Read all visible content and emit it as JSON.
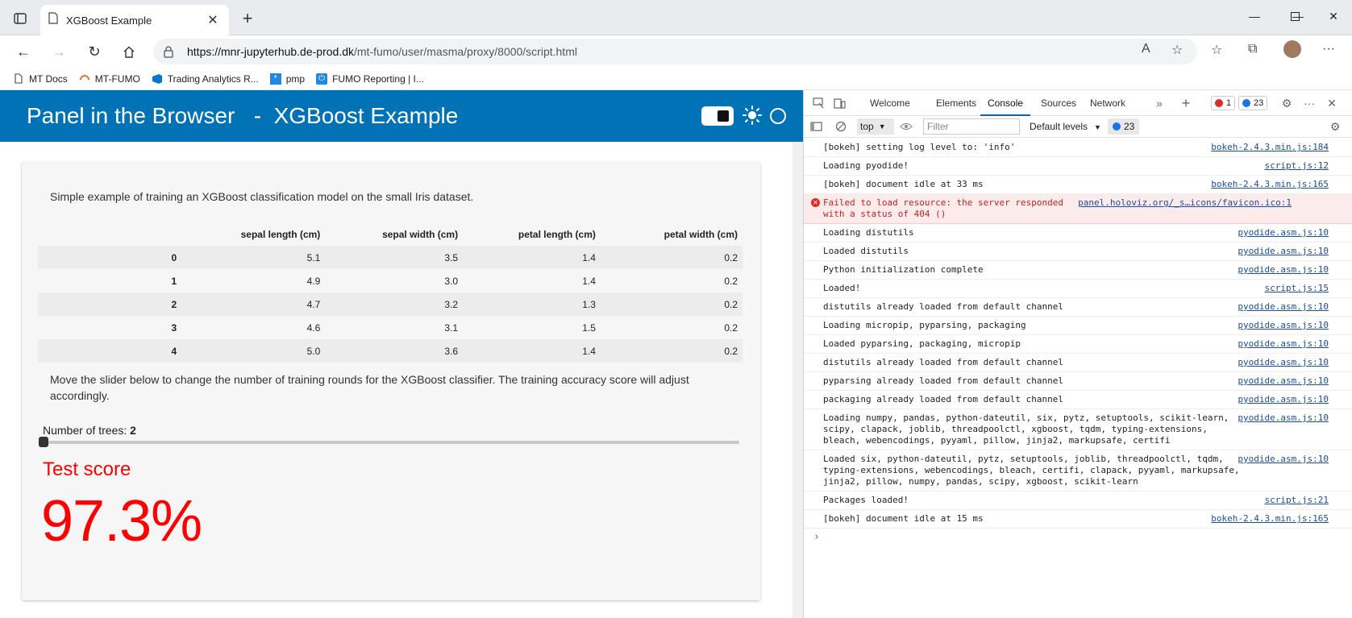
{
  "browser": {
    "tab_title": "XGBoost Example",
    "url_host": "https://mnr-jupyterhub.de-prod.dk",
    "url_path": "/mt-fumo/user/masma/proxy/8000/script.html",
    "bookmarks": [
      "MT Docs",
      "MT-FUMO",
      "Trading Analytics R...",
      "pmp",
      "FUMO Reporting | I..."
    ]
  },
  "app": {
    "title": "Panel in the Browser   -  XGBoost Example",
    "intro": "Simple example of training an XGBoost classification model on the small Iris dataset.",
    "table": {
      "columns": [
        "",
        "sepal length (cm)",
        "sepal width (cm)",
        "petal length (cm)",
        "petal width (cm)"
      ],
      "rows": [
        [
          "0",
          "5.1",
          "3.5",
          "1.4",
          "0.2"
        ],
        [
          "1",
          "4.9",
          "3.0",
          "1.4",
          "0.2"
        ],
        [
          "2",
          "4.7",
          "3.2",
          "1.3",
          "0.2"
        ],
        [
          "3",
          "4.6",
          "3.1",
          "1.5",
          "0.2"
        ],
        [
          "4",
          "5.0",
          "3.6",
          "1.4",
          "0.2"
        ]
      ]
    },
    "slider_text": "Move the slider below to change the number of training rounds for the XGBoost classifier. The training accuracy score will adjust accordingly.",
    "slider_label": "Number of trees: ",
    "slider_value": "2",
    "score_title": "Test score",
    "score_value": "97.3%"
  },
  "devtools": {
    "tabs": [
      "Welcome",
      "Elements",
      "Console",
      "Sources",
      "Network"
    ],
    "active_tab": "Console",
    "error_count": "1",
    "message_count": "23",
    "context": "top",
    "filter_placeholder": "Filter",
    "levels": "Default levels",
    "console": [
      {
        "text": "[bokeh] setting log level to: 'info'",
        "src": "bokeh-2.4.3.min.js:184"
      },
      {
        "text": "Loading pyodide!",
        "src": "script.js:12"
      },
      {
        "text": "[bokeh] document idle at 33 ms",
        "src": "bokeh-2.4.3.min.js:165"
      },
      {
        "text": "Failed to load resource: the server responded with a status of 404 ()",
        "src": "panel.holoviz.org/_s…icons/favicon.ico:1",
        "error": true
      },
      {
        "text": "Loading distutils",
        "src": "pyodide.asm.js:10"
      },
      {
        "text": "Loaded distutils",
        "src": "pyodide.asm.js:10"
      },
      {
        "text": "Python initialization complete",
        "src": "pyodide.asm.js:10"
      },
      {
        "text": "Loaded!",
        "src": "script.js:15"
      },
      {
        "text": "distutils already loaded from default channel",
        "src": "pyodide.asm.js:10"
      },
      {
        "text": "Loading micropip, pyparsing, packaging",
        "src": "pyodide.asm.js:10"
      },
      {
        "text": "Loaded pyparsing, packaging, micropip",
        "src": "pyodide.asm.js:10"
      },
      {
        "text": "distutils already loaded from default channel",
        "src": "pyodide.asm.js:10"
      },
      {
        "text": "pyparsing already loaded from default channel",
        "src": "pyodide.asm.js:10"
      },
      {
        "text": "packaging already loaded from default channel",
        "src": "pyodide.asm.js:10"
      },
      {
        "text": "Loading numpy, pandas, python-dateutil, six, pytz, setuptools, scikit-learn, scipy, clapack, joblib, threadpoolctl, xgboost, tqdm, typing-extensions, bleach, webencodings, pyyaml, pillow, jinja2, markupsafe, certifi",
        "src": "pyodide.asm.js:10"
      },
      {
        "text": "Loaded six, python-dateutil, pytz, setuptools, joblib, threadpoolctl, tqdm, typing-extensions, webencodings, bleach, certifi, clapack, pyyaml, markupsafe, jinja2, pillow, numpy, pandas, scipy, xgboost, scikit-learn",
        "src": "pyodide.asm.js:10"
      },
      {
        "text": "Packages loaded!",
        "src": "script.js:21"
      },
      {
        "text": "[bokeh] document idle at 15 ms",
        "src": "bokeh-2.4.3.min.js:165"
      }
    ]
  }
}
